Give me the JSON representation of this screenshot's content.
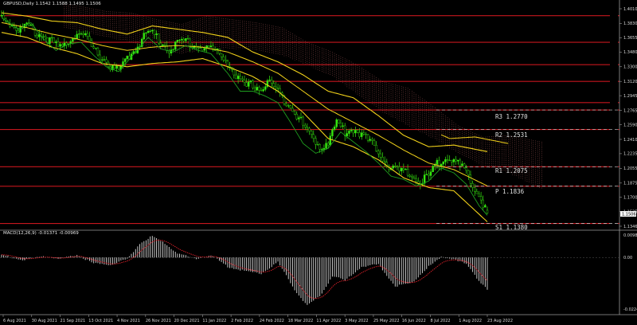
{
  "header": {
    "symbol_line": "GBPUSD,Daily  1.1542 1.1588 1.1495 1.1506",
    "macd_line": "MACD(12,26,9) -0.01371 -0.00969"
  },
  "colors": {
    "background": "#000000",
    "candles": "#35e80f",
    "ma_yellow": "#f2d21a",
    "fast_line": "#1fa01f",
    "level_red": "#c4161d",
    "cloud": "#ff8a8a",
    "macd_hist": "#d8d8d8",
    "macd_signal": "#e0202a",
    "axis_text": "#d8d8d8"
  },
  "price_axis": {
    "ticks": [
      "1.4010",
      "1.3830",
      "1.3655",
      "1.3480",
      "1.3300",
      "1.3120",
      "1.2945",
      "1.2765",
      "1.2590",
      "1.2410",
      "1.2235",
      "1.2055",
      "1.1875",
      "1.1700",
      "1.1525",
      "1.1346"
    ],
    "current_price": "1.1506"
  },
  "macd_axis": {
    "ticks": [
      "0.00981",
      "0.00",
      "-0.02246"
    ]
  },
  "time_axis": {
    "ticks": [
      "6 Aug 2021",
      "30 Aug 2021",
      "21 Sep 2021",
      "13 Oct 2021",
      "4 Nov 2021",
      "26 Nov 2021",
      "20 Dec 2021",
      "11 Jan 2022",
      "2 Feb 2022",
      "24 Feb 2022",
      "18 Mar 2022",
      "11 Apr 2022",
      "3 May 2022",
      "25 May 2022",
      "16 Jun 2022",
      "8 Jul 2022",
      "1 Aug 2022",
      "23 Aug 2022"
    ]
  },
  "pivot_labels": {
    "r3": "R3 1.2770",
    "r2": "R2 1.2531",
    "r1": "R1 1.2075",
    "p": "P 1.1836",
    "s1": "S1 1.1380"
  },
  "chart_data": {
    "type": "candlestick",
    "symbol": "GBPUSD",
    "timeframe": "Daily",
    "last_bar": {
      "open": 1.1542,
      "high": 1.1588,
      "low": 1.1495,
      "close": 1.1506
    },
    "ylim": [
      1.1346,
      1.401
    ],
    "x_range": [
      "6 Aug 2021",
      "23 Aug 2022"
    ],
    "close_path": [
      [
        0,
        1.392
      ],
      [
        4,
        1.384
      ],
      [
        8,
        1.375
      ],
      [
        12,
        1.38
      ],
      [
        16,
        1.372
      ],
      [
        20,
        1.368
      ],
      [
        24,
        1.36
      ],
      [
        28,
        1.352
      ],
      [
        32,
        1.362
      ],
      [
        36,
        1.372
      ],
      [
        40,
        1.366
      ],
      [
        44,
        1.35
      ],
      [
        48,
        1.342
      ],
      [
        52,
        1.33
      ],
      [
        56,
        1.325
      ],
      [
        60,
        1.34
      ],
      [
        64,
        1.352
      ],
      [
        68,
        1.368
      ],
      [
        72,
        1.372
      ],
      [
        76,
        1.36
      ],
      [
        80,
        1.352
      ],
      [
        84,
        1.358
      ],
      [
        88,
        1.362
      ],
      [
        92,
        1.356
      ],
      [
        96,
        1.354
      ],
      [
        100,
        1.352
      ],
      [
        104,
        1.345
      ],
      [
        108,
        1.336
      ],
      [
        112,
        1.318
      ],
      [
        116,
        1.305
      ],
      [
        120,
        1.308
      ],
      [
        124,
        1.302
      ],
      [
        128,
        1.312
      ],
      [
        132,
        1.298
      ],
      [
        136,
        1.288
      ],
      [
        140,
        1.276
      ],
      [
        144,
        1.258
      ],
      [
        148,
        1.245
      ],
      [
        152,
        1.232
      ],
      [
        156,
        1.238
      ],
      [
        160,
        1.262
      ],
      [
        164,
        1.25
      ],
      [
        168,
        1.254
      ],
      [
        172,
        1.248
      ],
      [
        176,
        1.236
      ],
      [
        180,
        1.228
      ],
      [
        184,
        1.21
      ],
      [
        188,
        1.204
      ],
      [
        192,
        1.2
      ],
      [
        196,
        1.196
      ],
      [
        200,
        1.188
      ],
      [
        204,
        1.196
      ],
      [
        208,
        1.21
      ],
      [
        212,
        1.222
      ],
      [
        216,
        1.214
      ],
      [
        220,
        1.206
      ],
      [
        224,
        1.188
      ],
      [
        228,
        1.174
      ],
      [
        232,
        1.151
      ]
    ],
    "moving_average": [
      [
        0,
        1.384
      ],
      [
        12,
        1.378
      ],
      [
        24,
        1.37
      ],
      [
        36,
        1.364
      ],
      [
        48,
        1.356
      ],
      [
        60,
        1.35
      ],
      [
        72,
        1.354
      ],
      [
        84,
        1.356
      ],
      [
        96,
        1.354
      ],
      [
        108,
        1.348
      ],
      [
        120,
        1.336
      ],
      [
        132,
        1.322
      ],
      [
        144,
        1.3
      ],
      [
        156,
        1.278
      ],
      [
        168,
        1.262
      ],
      [
        180,
        1.246
      ],
      [
        192,
        1.228
      ],
      [
        204,
        1.212
      ],
      [
        216,
        1.204
      ],
      [
        232,
        1.184
      ]
    ],
    "bollinger_upper": [
      [
        0,
        1.396
      ],
      [
        12,
        1.392
      ],
      [
        24,
        1.386
      ],
      [
        36,
        1.384
      ],
      [
        48,
        1.376
      ],
      [
        60,
        1.37
      ],
      [
        72,
        1.38
      ],
      [
        84,
        1.376
      ],
      [
        96,
        1.372
      ],
      [
        108,
        1.366
      ],
      [
        120,
        1.348
      ],
      [
        132,
        1.336
      ],
      [
        144,
        1.32
      ],
      [
        156,
        1.3
      ],
      [
        168,
        1.292
      ],
      [
        180,
        1.27
      ],
      [
        192,
        1.246
      ],
      [
        204,
        1.232
      ],
      [
        216,
        1.234
      ],
      [
        232,
        1.226
      ]
    ],
    "bollinger_lower": [
      [
        0,
        1.372
      ],
      [
        12,
        1.366
      ],
      [
        24,
        1.354
      ],
      [
        36,
        1.346
      ],
      [
        48,
        1.334
      ],
      [
        60,
        1.33
      ],
      [
        72,
        1.334
      ],
      [
        84,
        1.336
      ],
      [
        96,
        1.34
      ],
      [
        108,
        1.33
      ],
      [
        120,
        1.318
      ],
      [
        132,
        1.3
      ],
      [
        144,
        1.274
      ],
      [
        156,
        1.242
      ],
      [
        168,
        1.232
      ],
      [
        180,
        1.216
      ],
      [
        192,
        1.194
      ],
      [
        204,
        1.182
      ],
      [
        216,
        1.178
      ],
      [
        232,
        1.14
      ]
    ],
    "fast_line": [
      [
        0,
        1.39
      ],
      [
        8,
        1.376
      ],
      [
        14,
        1.384
      ],
      [
        20,
        1.364
      ],
      [
        26,
        1.35
      ],
      [
        32,
        1.358
      ],
      [
        38,
        1.36
      ],
      [
        44,
        1.344
      ],
      [
        50,
        1.33
      ],
      [
        56,
        1.324
      ],
      [
        62,
        1.342
      ],
      [
        70,
        1.366
      ],
      [
        76,
        1.352
      ],
      [
        82,
        1.348
      ],
      [
        88,
        1.356
      ],
      [
        94,
        1.35
      ],
      [
        100,
        1.346
      ],
      [
        108,
        1.322
      ],
      [
        114,
        1.3
      ],
      [
        120,
        1.3
      ],
      [
        126,
        1.294
      ],
      [
        132,
        1.286
      ],
      [
        138,
        1.262
      ],
      [
        144,
        1.236
      ],
      [
        150,
        1.224
      ],
      [
        156,
        1.23
      ],
      [
        162,
        1.25
      ],
      [
        168,
        1.238
      ],
      [
        174,
        1.226
      ],
      [
        180,
        1.212
      ],
      [
        186,
        1.196
      ],
      [
        192,
        1.192
      ],
      [
        198,
        1.184
      ],
      [
        204,
        1.19
      ],
      [
        210,
        1.206
      ],
      [
        216,
        1.2
      ],
      [
        222,
        1.186
      ],
      [
        228,
        1.16
      ],
      [
        232,
        1.148
      ]
    ],
    "horizontal_levels": [
      1.3925,
      1.36,
      1.3325,
      1.312,
      1.286,
      1.277,
      1.2531,
      1.2075,
      1.1836,
      1.138
    ],
    "pivots": {
      "R3": 1.277,
      "R2": 1.2531,
      "R1": 1.2075,
      "P": 1.1836,
      "S1": 1.138
    },
    "macd": {
      "fast": 12,
      "slow": 26,
      "signal_period": 9,
      "main": -0.01371,
      "signal": -0.00969,
      "ylim": [
        -0.02246,
        0.00981
      ],
      "histogram_path": [
        [
          0,
          0.0012
        ],
        [
          10,
          -0.0012
        ],
        [
          20,
          0.0006
        ],
        [
          28,
          -0.0008
        ],
        [
          36,
          0.0012
        ],
        [
          44,
          -0.0026
        ],
        [
          52,
          -0.0032
        ],
        [
          60,
          -0.0006
        ],
        [
          66,
          0.006
        ],
        [
          72,
          0.0094
        ],
        [
          78,
          0.006
        ],
        [
          84,
          0.002
        ],
        [
          92,
          -0.0006
        ],
        [
          100,
          0.001
        ],
        [
          108,
          -0.004
        ],
        [
          116,
          -0.0058
        ],
        [
          124,
          -0.007
        ],
        [
          132,
          -0.002
        ],
        [
          140,
          -0.014
        ],
        [
          146,
          -0.021
        ],
        [
          152,
          -0.017
        ],
        [
          158,
          -0.008
        ],
        [
          164,
          -0.01
        ],
        [
          172,
          -0.004
        ],
        [
          180,
          -0.003
        ],
        [
          188,
          -0.0125
        ],
        [
          196,
          -0.011
        ],
        [
          204,
          -0.004
        ],
        [
          210,
          0.0
        ],
        [
          216,
          -0.0005
        ],
        [
          222,
          -0.003
        ],
        [
          228,
          -0.01
        ],
        [
          232,
          -0.0137
        ]
      ]
    }
  }
}
